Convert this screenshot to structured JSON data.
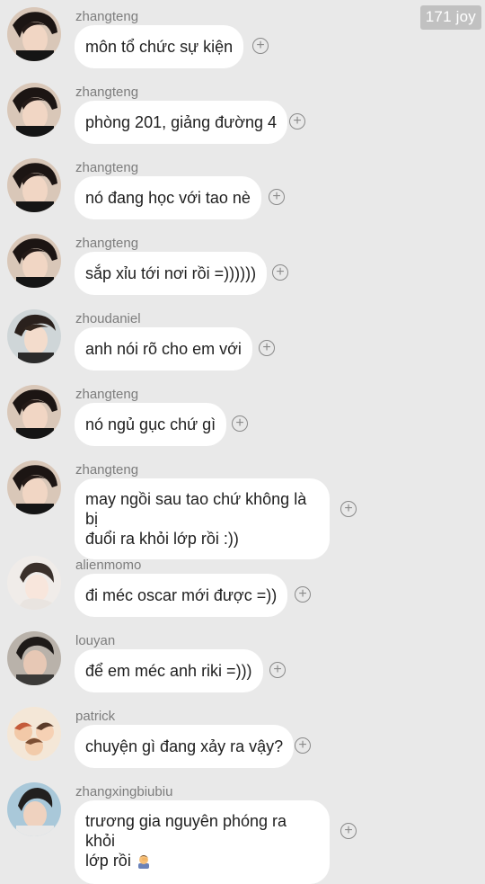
{
  "watermark": "171 joy",
  "messages": [
    {
      "username": "zhangteng",
      "text": "môn tổ chức sự kiện",
      "avatar": "zhangteng"
    },
    {
      "username": "zhangteng",
      "text": "phòng 201, giảng đường 4",
      "avatar": "zhangteng"
    },
    {
      "username": "zhangteng",
      "text": "nó đang học với tao nè",
      "avatar": "zhangteng"
    },
    {
      "username": "zhangteng",
      "text": "sắp xỉu tới nơi rồi =))))))",
      "avatar": "zhangteng"
    },
    {
      "username": "zhoudaniel",
      "text": "anh nói rõ cho em với",
      "avatar": "zhoudaniel"
    },
    {
      "username": "zhangteng",
      "text": "nó ngủ gục chứ gì",
      "avatar": "zhangteng"
    },
    {
      "username": "zhangteng",
      "text_line1": "may ngồi sau tao chứ không là bị",
      "text_line2": "đuổi ra khỏi lớp rồi :))",
      "avatar": "zhangteng"
    },
    {
      "username": "alienmomo",
      "text": "đi méc oscar mới được =))",
      "avatar": "alienmomo"
    },
    {
      "username": "louyan",
      "text": "để em méc anh riki =)))",
      "avatar": "louyan"
    },
    {
      "username": "patrick",
      "text": "chuyện gì đang xảy ra vậy?",
      "avatar": "patrick"
    },
    {
      "username": "zhangxingbiubiu",
      "text_line1": "trương gia nguyên phóng ra khỏi",
      "text_line2": "lớp rồi",
      "emoji": "person-facepalming",
      "avatar": "zhangxingbiubiu"
    }
  ],
  "icons": {
    "add": "plus-circle-icon"
  }
}
